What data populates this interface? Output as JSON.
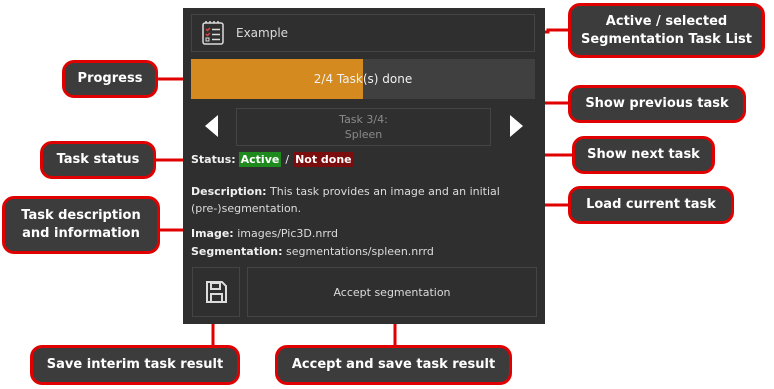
{
  "task_list": {
    "name": "Example",
    "icon": "checklist-icon"
  },
  "progress": {
    "text": "2/4 Task(s) done",
    "done": 2,
    "total": 4,
    "fraction": 0.5,
    "color": "#d48a1e"
  },
  "navigation": {
    "prev_icon": "triangle-left-icon",
    "next_icon": "triangle-right-icon"
  },
  "current_task": {
    "line1": "Task 3/4:",
    "line2": "Spleen"
  },
  "status": {
    "label": "Status:",
    "active": "Active",
    "separator": "/",
    "done_state": "Not done",
    "active_color": "#1e8a1e",
    "not_done_color": "#7a0d0d"
  },
  "description": {
    "label": "Description:",
    "text": "This task provides an image and an initial (pre-)segmentation."
  },
  "image": {
    "label": "Image:",
    "value": "images/Pic3D.nrrd"
  },
  "segmentation": {
    "label": "Segmentation:",
    "value": "segmentations/spleen.nrrd"
  },
  "buttons": {
    "save_icon": "floppy-disk-icon",
    "accept_label": "Accept segmentation"
  },
  "callouts": {
    "task_list": "Active / selected Segmentation Task List",
    "progress": "Progress",
    "prev": "Show previous task",
    "status": "Task status",
    "next": "Show next task",
    "description": "Task description and information",
    "load": "Load current task",
    "save": "Save interim task result",
    "accept": "Accept and save task result"
  },
  "accent_color": "#e00000"
}
